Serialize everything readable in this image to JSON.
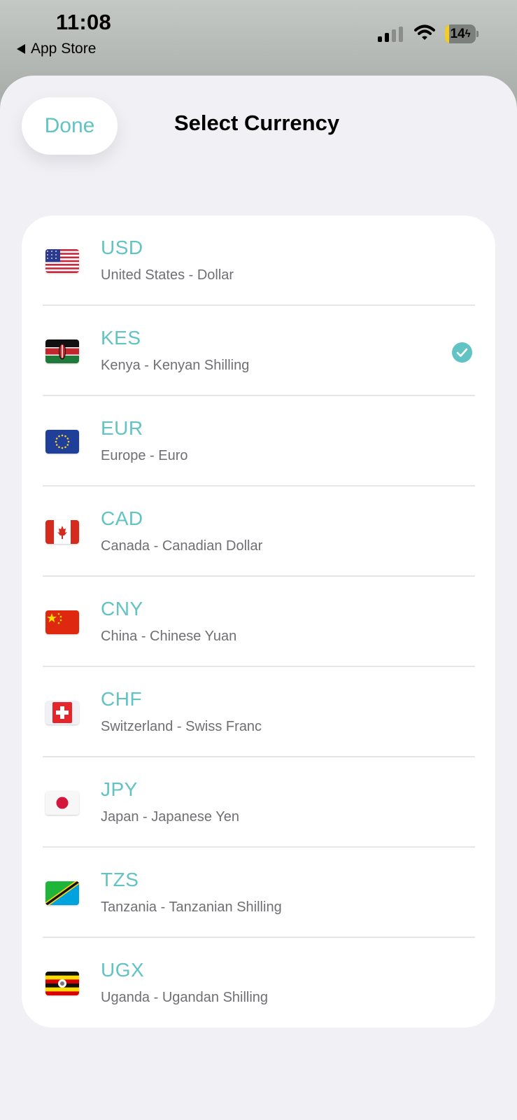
{
  "status_bar": {
    "time": "11:08",
    "back_label": "App Store",
    "battery_level": "14"
  },
  "header": {
    "done_label": "Done",
    "title": "Select Currency"
  },
  "accent_color": "#62c3c4",
  "selected_code": "KES",
  "currencies": [
    {
      "code": "USD",
      "description": "United States - Dollar",
      "flag_icon": "us-flag-icon"
    },
    {
      "code": "KES",
      "description": "Kenya - Kenyan Shilling",
      "flag_icon": "kenya-flag-icon"
    },
    {
      "code": "EUR",
      "description": "Europe - Euro",
      "flag_icon": "eu-flag-icon"
    },
    {
      "code": "CAD",
      "description": "Canada - Canadian Dollar",
      "flag_icon": "canada-flag-icon"
    },
    {
      "code": "CNY",
      "description": "China - Chinese Yuan",
      "flag_icon": "china-flag-icon"
    },
    {
      "code": "CHF",
      "description": "Switzerland - Swiss Franc",
      "flag_icon": "switzerland-flag-icon"
    },
    {
      "code": "JPY",
      "description": "Japan - Japanese Yen",
      "flag_icon": "japan-flag-icon"
    },
    {
      "code": "TZS",
      "description": "Tanzania - Tanzanian Shilling",
      "flag_icon": "tanzania-flag-icon"
    },
    {
      "code": "UGX",
      "description": "Uganda - Ugandan Shilling",
      "flag_icon": "uganda-flag-icon"
    }
  ]
}
